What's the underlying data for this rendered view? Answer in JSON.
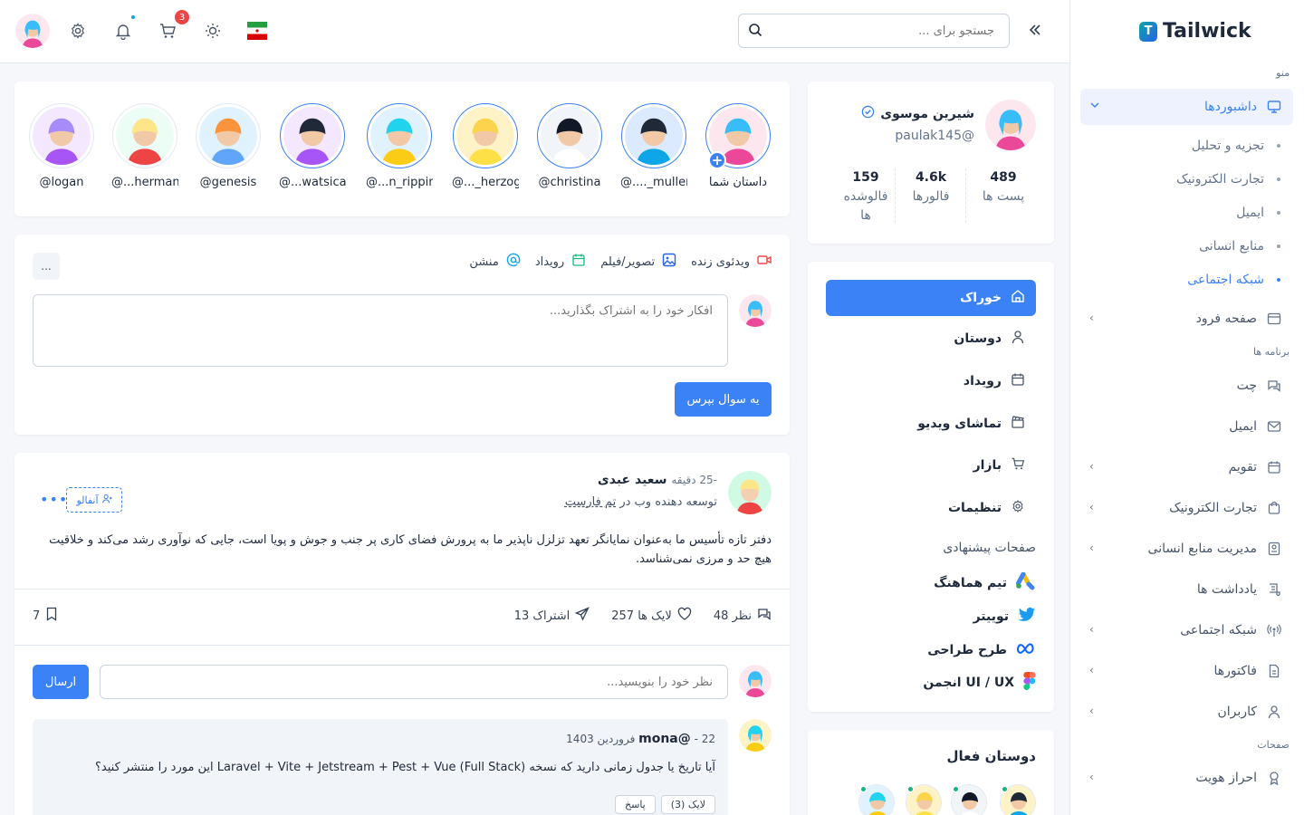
{
  "sidebar": {
    "brand": "Tailwick",
    "section_menu": "منو",
    "section_apps": "برنامه ها",
    "section_pages": "صفحات",
    "dashboards": "داشبوردها",
    "sub": [
      "تجزیه و تحلیل",
      "تجارت الکترونیک",
      "ایمیل",
      "منابع انسانی",
      "شبکه اجتماعی"
    ],
    "landing": "صفحه فرود",
    "apps": [
      "چت",
      "ایمیل",
      "تقویم",
      "تجارت الکترونیک",
      "مدیریت منابع انسانی",
      "یادداشت ها",
      "شبکه اجتماعی",
      "فاکتورها",
      "کاربران"
    ],
    "auth": "احراز هویت"
  },
  "topbar": {
    "search_placeholder": "جستجو برای ...",
    "cart_count": "3"
  },
  "profile": {
    "name": "شیرین موسوی",
    "username": "paulak145@",
    "stats": [
      {
        "value": "489",
        "label": "پست ها"
      },
      {
        "value": "4.6k",
        "label": "فالورها"
      },
      {
        "value": "159",
        "label": "فالوشده ها"
      }
    ]
  },
  "nav": {
    "items": [
      "خوراک",
      "دوستان",
      "رویداد",
      "تماشای ویدیو",
      "بازار",
      "تنظیمات"
    ],
    "suggested_heading": "صفحات پیشنهادی",
    "pages": [
      "تیم هماهنگ",
      "توییتر",
      "طرح طراحی",
      "انجمن UI / UX"
    ]
  },
  "friends": {
    "title": "دوستان فعال"
  },
  "stories": [
    "داستان شما",
    "@...._muller",
    "@christina",
    "@..._herzog",
    "@...n_rippin",
    "@...watsica",
    "@genesis",
    "@...herman",
    "@logan"
  ],
  "composer": {
    "tools": [
      "ویدئوی زنده",
      "تصویر/فیلم",
      "رویداد",
      "منشن"
    ],
    "more": "...",
    "placeholder": "افکار خود را به اشتراک بگذارید...",
    "submit": "یه سوال بپرس"
  },
  "post": {
    "author": "سعید عبدی",
    "time": "-25 دقیقه",
    "role_prefix": "توسعه دهنده وب در",
    "role_link": "تم فارست",
    "unfollow": "آنفالو",
    "body": "دفتر تازه تأسیس ما به‌عنوان نمایانگر تعهد تزلزل ناپذیر ما به پرورش فضای کاری پر جنب و جوش و پویا است، جایی که نوآوری رشد می‌کند و خلاقیت هیچ حد و مرزی نمی‌شناسد.",
    "comments": "48 نظر",
    "likes": "257 لایک ها",
    "shares": "13 اشتراک",
    "bookmarks": "7",
    "comment_placeholder": "نظر خود را بنویسید...",
    "send": "ارسال",
    "reply": {
      "user": "mona@",
      "meta": "- 22 فروردین 1403",
      "text": "آیا تاریخ یا جدول زمانی دارید که نسخه (Full Stack) Laravel + Vite + Jetstream + Pest + Vue این مورد را منتشر کنید؟",
      "like": "لایک (3)",
      "answer": "پاسخ"
    }
  }
}
